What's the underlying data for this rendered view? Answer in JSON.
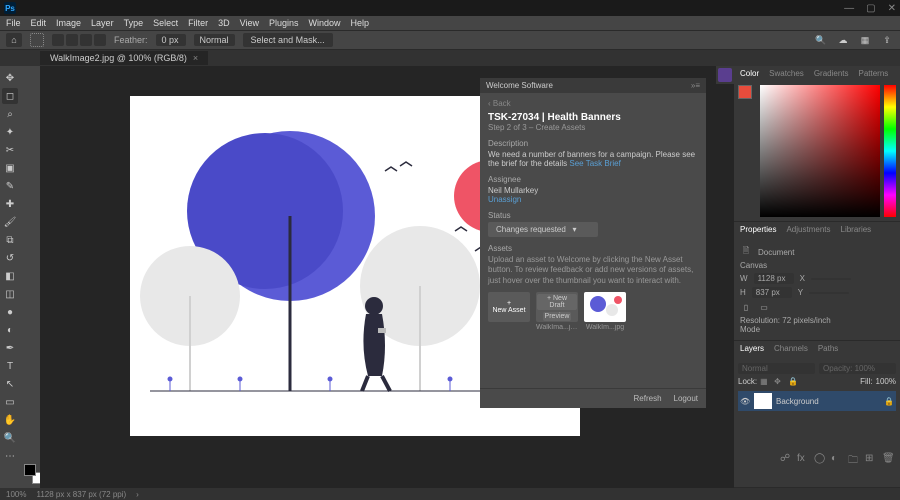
{
  "app": {
    "icon_text": "Ps"
  },
  "menu": [
    "File",
    "Edit",
    "Image",
    "Layer",
    "Type",
    "Select",
    "Filter",
    "3D",
    "View",
    "Plugins",
    "Window",
    "Help"
  ],
  "options": {
    "feather_label": "Feather:",
    "feather_value": "0 px",
    "style_value": "Normal",
    "select_mask": "Select and Mask..."
  },
  "tab": {
    "title": "WalkImage2.jpg @ 100% (RGB/8)"
  },
  "statusbar": {
    "zoom": "100%",
    "info": "1128 px x 837 px (72 ppi)"
  },
  "panels": {
    "color_tabs": [
      "Color",
      "Swatches",
      "Gradients",
      "Patterns"
    ],
    "props_tabs": [
      "Properties",
      "Adjustments",
      "Libraries"
    ],
    "layers_tabs": [
      "Layers",
      "Channels",
      "Paths"
    ]
  },
  "properties": {
    "doc_label": "Document",
    "canvas_label": "Canvas",
    "w_label": "W",
    "w_value": "1128 px",
    "h_label": "H",
    "h_value": "837 px",
    "x_label": "X",
    "y_label": "Y",
    "resolution": "Resolution: 72 pixels/inch",
    "mode_label": "Mode"
  },
  "layers": {
    "blend": "Normal",
    "opacity_label": "Opacity:",
    "opacity": "100%",
    "lock_label": "Lock:",
    "fill_label": "Fill:",
    "fill": "100%",
    "layer_name": "Background"
  },
  "plugin": {
    "header": "Welcome Software",
    "back": "Back",
    "task_title": "TSK-27034 | Health Banners",
    "step": "Step 2 of 3 – Create Assets",
    "desc_label": "Description",
    "desc_text": "We need a number of banners for a campaign. Please see the brief for the details",
    "desc_link": "See Task Brief",
    "assignee_label": "Assignee",
    "assignee_name": "Neil Mullarkey",
    "unassign": "Unassign",
    "status_label": "Status",
    "status_value": "Changes requested",
    "assets_label": "Assets",
    "assets_hint": "Upload an asset to Welcome by clicking the New Asset button. To review feedback or add new versions of assets, just hover over the thumbnail you want to interact with.",
    "new_asset_plus": "+",
    "new_asset": "New Asset",
    "new_draft": "+ New Draft",
    "preview": "Preview",
    "asset1": "WalkIma...jpg",
    "asset2": "WalkIm...jpg",
    "refresh": "Refresh",
    "logout": "Logout"
  }
}
